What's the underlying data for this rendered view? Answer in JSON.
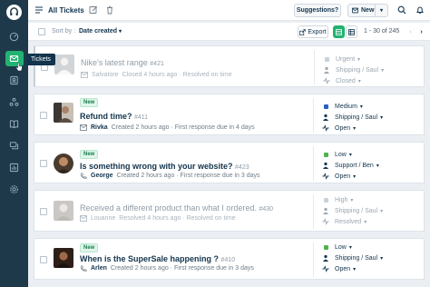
{
  "sidebar": {
    "tooltip": "Tickets"
  },
  "header": {
    "title": "All Tickets",
    "suggestions_label": "Suggestions?",
    "new_label": "New"
  },
  "toolbar": {
    "sort_prefix": "Sort by :",
    "sort_value": "Date created",
    "export_label": "Export",
    "pagination": "1 - 30 of 245"
  },
  "tickets": [
    {
      "is_new": false,
      "title": "Nike's latest range",
      "number": "#421",
      "meta_name": "Salvatore",
      "meta_text": "Closed 4 hours ago · Resolved on time",
      "priority": "Urgent",
      "priority_color": "#c9d2da",
      "group": "Shipping / Saul",
      "status": "Closed"
    },
    {
      "is_new": true,
      "new_label": "New",
      "title": "Refund time?",
      "number": "#411",
      "meta_name": "Rivka",
      "meta_text": "Created 2 hours ago · First response due in 4 days",
      "priority": "Medium",
      "priority_color": "#2c5cc5",
      "group": "Shipping / Saul",
      "status": "Open"
    },
    {
      "is_new": true,
      "new_label": "New",
      "title": "Is something wrong with your website?",
      "number": "#423",
      "meta_name": "George",
      "meta_text": "Created 2 hours ago · First response due in 3 days",
      "priority": "Low",
      "priority_color": "#4db34d",
      "group": "Support / Ben",
      "status": "Open"
    },
    {
      "is_new": false,
      "title": "Received a different product than what I ordered.",
      "number": "#430",
      "meta_name": "Louanne",
      "meta_text": "Resolved 4 hours ago · Resolved on time",
      "priority": "High",
      "priority_color": "#c9d2da",
      "group": "Shipping / Saul",
      "status": "Resolved"
    },
    {
      "is_new": true,
      "new_label": "New",
      "title": "When is the SuperSale happening ?",
      "number": "#410",
      "meta_name": "Arlen",
      "meta_text": "Created 2 hours ago · First response due in 3 days",
      "priority": "Low",
      "priority_color": "#4db34d",
      "group": "Shipping / Saul",
      "status": "Open"
    }
  ]
}
